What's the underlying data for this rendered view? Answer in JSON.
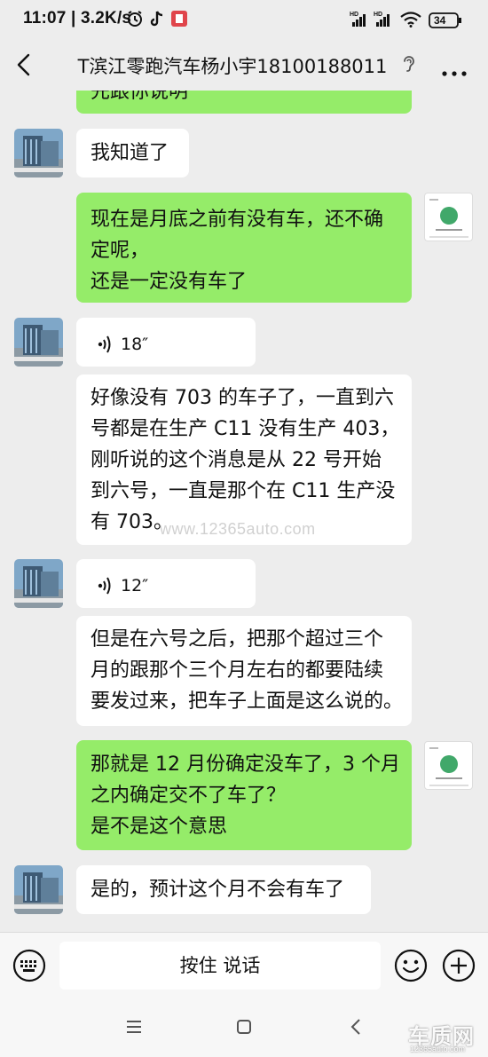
{
  "status_bar": {
    "time_speed": "11:07 | 3.2K/s",
    "signal_1": "HD",
    "signal_2": "HD",
    "battery": "34"
  },
  "header": {
    "title": "T滨江零跑汽车杨小宇18100188011"
  },
  "messages": [
    {
      "id": "m0",
      "side": "out",
      "lines": [
        "先跟你说明"
      ]
    },
    {
      "id": "m1",
      "side": "in",
      "lines": [
        "我知道了"
      ]
    },
    {
      "id": "m2",
      "side": "out",
      "lines": [
        "现在是月底之前有没有车，还不确",
        "定呢，",
        "还是一定没有车了"
      ]
    },
    {
      "id": "m3",
      "side": "in",
      "type": "voice",
      "duration": "18″"
    },
    {
      "id": "m4",
      "side": "in",
      "lines": [
        "好像没有 703 的车子了，一直到六",
        "号都是在生产 C11 没有生产 403，",
        "刚听说的这个消息是从 22 号开始",
        "到六号，一直是那个在 C11 生产没",
        "有 703。"
      ]
    },
    {
      "id": "m5",
      "side": "in",
      "type": "voice",
      "duration": "12″"
    },
    {
      "id": "m6",
      "side": "in",
      "lines": [
        "但是在六号之后，把那个超过三个",
        "月的跟那个三个月左右的都要陆续",
        "要发过来，把车子上面是这么说的。"
      ]
    },
    {
      "id": "m7",
      "side": "out",
      "lines": [
        "那就是 12 月份确定没车了，3 个月",
        "之内确定交不了车了？",
        "是不是这个意思"
      ]
    },
    {
      "id": "m8",
      "side": "in",
      "lines": [
        "是的，预计这个月不会有车了"
      ]
    }
  ],
  "watermark": "www.12365auto.com",
  "input_bar": {
    "hold_to_talk": "按住 说话"
  },
  "logo": {
    "big": "车质网",
    "small": "12365auto.com"
  },
  "colors": {
    "outgoing_bubble": "#95ec69",
    "incoming_bubble": "#ffffff",
    "background": "#ededed"
  }
}
